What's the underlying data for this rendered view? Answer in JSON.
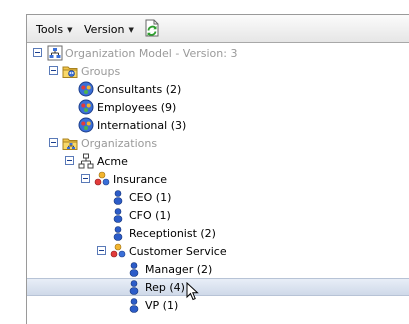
{
  "toolbar": {
    "tools_label": "Tools",
    "version_label": "Version",
    "refresh_icon": "refresh-page-icon"
  },
  "tree": {
    "root": {
      "label": "Organization Model - Version: 3",
      "icon": "org-model-icon"
    },
    "groups": {
      "label": "Groups",
      "icon": "folder-group-icon",
      "items": [
        {
          "label": "Consultants  (2)",
          "icon": "group-icon"
        },
        {
          "label": "Employees  (9)",
          "icon": "group-icon"
        },
        {
          "label": "International  (3)",
          "icon": "group-icon"
        }
      ]
    },
    "organizations": {
      "label": "Organizations",
      "icon": "folder-org-icon",
      "acme": {
        "label": "Acme",
        "icon": "org-chart-icon",
        "insurance": {
          "label": "Insurance",
          "icon": "org-unit-icon",
          "positions": [
            {
              "label": "CEO  (1)",
              "icon": "person-icon"
            },
            {
              "label": "CFO  (1)",
              "icon": "person-icon"
            },
            {
              "label": "Receptionist  (2)",
              "icon": "person-icon"
            }
          ],
          "customer_service": {
            "label": "Customer Service",
            "icon": "org-unit-icon",
            "positions": [
              {
                "label": "Manager  (2)",
                "icon": "person-icon"
              },
              {
                "label": "Rep  (4)",
                "icon": "person-icon",
                "selected": true
              },
              {
                "label": "VP  (1)",
                "icon": "person-icon"
              }
            ]
          }
        }
      }
    }
  },
  "colors": {
    "selection_bg": "#d3dcea",
    "disabled_text": "#9a9a9a",
    "person_blue": "#2c5cc8"
  }
}
